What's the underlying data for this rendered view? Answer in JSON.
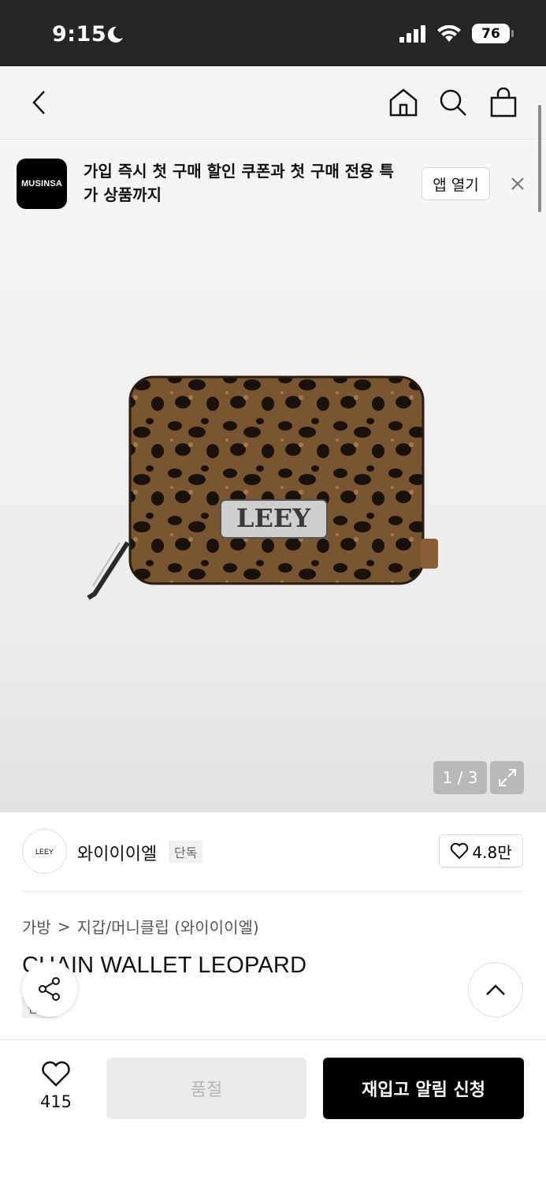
{
  "status_bar": {
    "time": "9:15",
    "battery": "76"
  },
  "banner": {
    "app_name": "MUSINSA",
    "text": "가입 즉시 첫 구매 할인 쿠폰과 첫 구매 전용 특가 상품까지",
    "open_app_label": "앱 열기"
  },
  "product_image": {
    "logo_text": "LEEY",
    "counter": "1 / 3"
  },
  "brand": {
    "logo_text": "LEEY",
    "name": "와이이이엘",
    "tag": "단독",
    "likes": "4.8만"
  },
  "breadcrumb": {
    "category": "가방",
    "separator": ">",
    "subcategory": "지갑/머니클립 (와이이이엘)"
  },
  "product": {
    "title": "CHAIN WALLET LEOPARD",
    "tag": "단독"
  },
  "bottom_bar": {
    "wish_count": "415",
    "soldout_label": "품절",
    "restock_label": "재입고 알림 신청"
  },
  "colors": {
    "accent": "#000000",
    "status_bar": "#252525",
    "disabled": "#ebebeb"
  }
}
